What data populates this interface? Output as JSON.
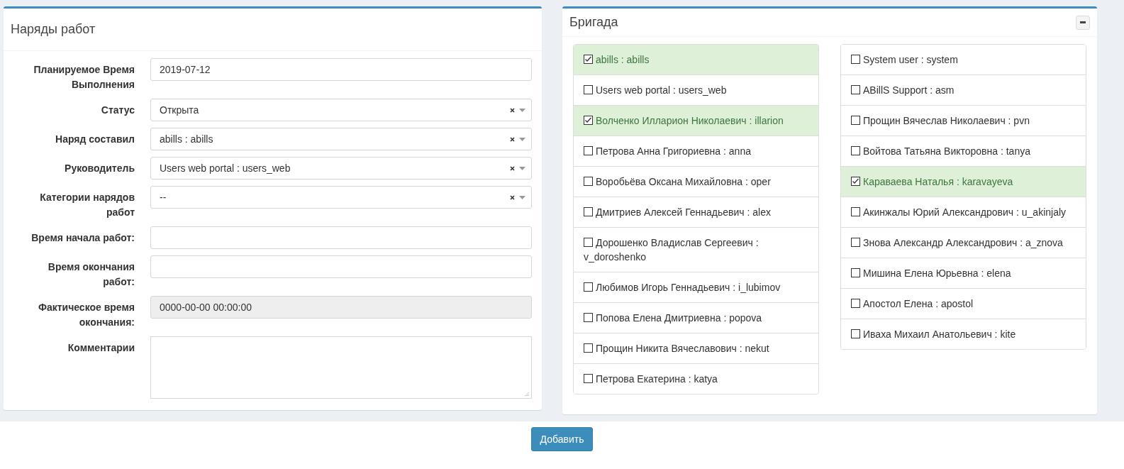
{
  "orders_panel": {
    "title": "Наряды работ",
    "fields": [
      {
        "kind": "text",
        "label": "Планируемое Время Выполнения",
        "value": "2019-07-12"
      },
      {
        "kind": "select",
        "label": "Статус",
        "value": "Открыта"
      },
      {
        "kind": "select",
        "label": "Наряд составил",
        "value": "abills : abills"
      },
      {
        "kind": "select",
        "label": "Руководитель",
        "value": "Users web portal : users_web"
      },
      {
        "kind": "select",
        "label": "Категории нарядов работ",
        "value": "--"
      },
      {
        "kind": "text",
        "label": "Время начала работ:"
      },
      {
        "kind": "text",
        "label": "Время окончания работ:"
      },
      {
        "kind": "readonly",
        "label": "Фактическое время окончания:",
        "value": "0000-00-00 00:00:00"
      },
      {
        "kind": "textarea",
        "label": "Комментарии"
      }
    ]
  },
  "team_panel": {
    "title": "Бригада",
    "columns": [
      [
        {
          "label": "abills : abills",
          "checked": true
        },
        {
          "label": "Users web portal : users_web",
          "checked": false
        },
        {
          "label": "Волченко Илларион Николаевич : illarion",
          "checked": true
        },
        {
          "label": "Петрова Анна Григориевна : anna",
          "checked": false
        },
        {
          "label": "Воробьёва Оксана Михайловна : oper",
          "checked": false
        },
        {
          "label": "Дмитриев Алексей Геннадьевич : alex",
          "checked": false
        },
        {
          "label": "Дорошенко Владислав Сергеевич : v_doroshenko",
          "checked": false
        },
        {
          "label": "Любимов Игорь Геннадьевич : i_lubimov",
          "checked": false
        },
        {
          "label": "Попова Елена Дмитриевна : popova",
          "checked": false
        },
        {
          "label": "Прощин Никита Вячеславович : nekut",
          "checked": false
        },
        {
          "label": "Петрова Екатерина : katya",
          "checked": false
        }
      ],
      [
        {
          "label": "System user : system",
          "checked": false
        },
        {
          "label": "ABillS Support : asm",
          "checked": false
        },
        {
          "label": "Прощин Вячеслав Николаевич : pvn",
          "checked": false
        },
        {
          "label": "Войтова Татьяна Викторовна : tanya",
          "checked": false
        },
        {
          "label": "Караваева Наталья : karavayeva",
          "checked": true
        },
        {
          "label": "Акинжалы Юрий Александрович : u_akinjaly",
          "checked": false
        },
        {
          "label": "Знова Александр Александрович : a_znova",
          "checked": false
        },
        {
          "label": "Мишина Елена Юрьевна : elena",
          "checked": false
        },
        {
          "label": "Апостол Елена : apostol",
          "checked": false
        },
        {
          "label": "Иваха Михаил Анатольевич : kite",
          "checked": false
        }
      ]
    ]
  },
  "submit_button": "Добавить"
}
